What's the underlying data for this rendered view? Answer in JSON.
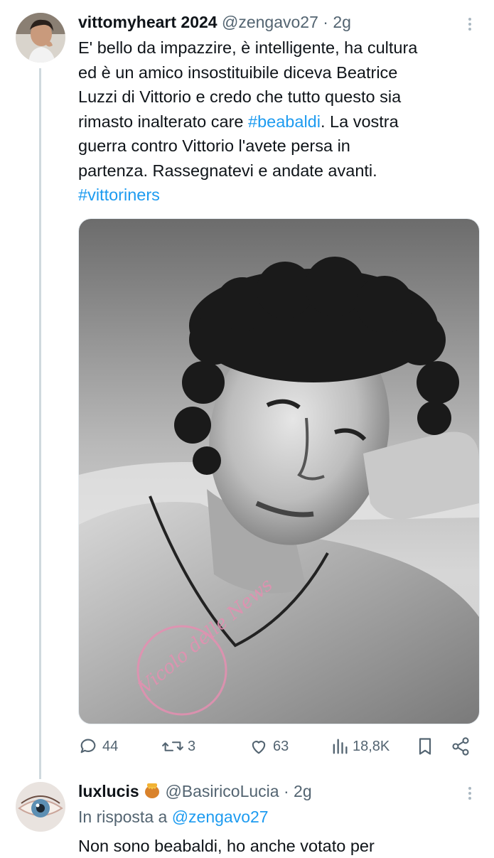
{
  "main_tweet": {
    "author_name": "vittomyheart 2024",
    "handle": "@zengavo27",
    "separator": "·",
    "time": "2g",
    "text_lines": [
      "E' bello da impazzire, è intelligente, ha cultura",
      "ed è un amico insostituibile diceva Beatrice",
      "Luzzi di Vittorio e credo che tutto questo sia",
      "rimasto inalterato care "
    ],
    "hashtag_1": "#beabaldi",
    "text_after_hashtag": ". La vostra",
    "text_lines_2": [
      "guerra contro Vittorio l'avete persa in",
      "partenza. Rassegnatevi e andate avanti."
    ],
    "hashtag_2": "#vittoriners",
    "watermark_text": "Vicolo delle News",
    "actions": {
      "replies": "44",
      "retweets": "3",
      "likes": "63",
      "views": "18,8K"
    }
  },
  "reply_tweet": {
    "author_name": "luxlucis",
    "author_emoji": "honey-pot-icon",
    "handle": "@BasiricoLucia",
    "separator": "·",
    "time": "2g",
    "in_reply_prefix": "In risposta a ",
    "in_reply_mention": "@zengavo27",
    "text_partial": "Non sono beabaldi, ho anche votato per"
  },
  "colors": {
    "link": "#1d9bf0",
    "muted": "#536471",
    "text": "#0f1419",
    "thread_line": "#cfd9de"
  }
}
